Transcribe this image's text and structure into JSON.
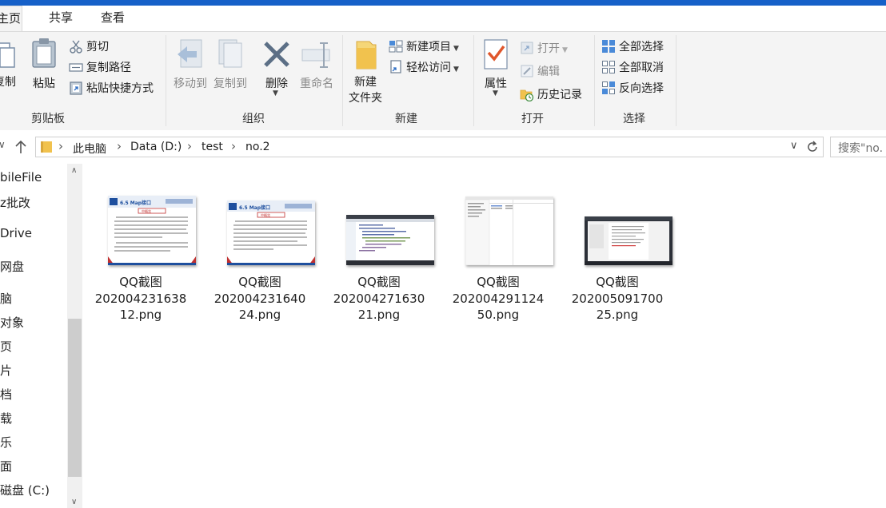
{
  "ribbon_tabs": [
    {
      "label": "主页",
      "active": true
    },
    {
      "label": "共享",
      "active": false
    },
    {
      "label": "查看",
      "active": false
    }
  ],
  "clipboard": {
    "group_label": "剪贴板",
    "copy_label": "复制",
    "paste_label": "粘贴",
    "cut_label": "剪切",
    "copy_path_label": "复制路径",
    "paste_shortcut_label": "粘贴快捷方式"
  },
  "organize": {
    "group_label": "组织",
    "move_to_label": "移动到",
    "copy_to_label": "复制到",
    "delete_label": "删除",
    "rename_label": "重命名"
  },
  "new": {
    "group_label": "新建",
    "new_folder_line1": "新建",
    "new_folder_line2": "文件夹",
    "new_item_label": "新建项目",
    "easy_access_label": "轻松访问"
  },
  "open": {
    "group_label": "打开",
    "properties_label": "属性",
    "open_label": "打开",
    "edit_label": "编辑",
    "history_label": "历史记录"
  },
  "select": {
    "group_label": "选择",
    "select_all_label": "全部选择",
    "select_none_label": "全部取消",
    "invert_label": "反向选择"
  },
  "breadcrumb": [
    "此电脑",
    "Data (D:)",
    "test",
    "no.2"
  ],
  "search_placeholder": "搜索\"no.",
  "sidebar_items": [
    "bileFile",
    "z批改",
    "Drive",
    "网盘",
    "脑",
    "对象",
    "页",
    "片",
    "档",
    "载",
    "乐",
    "面",
    "磁盘 (C:)"
  ],
  "files": [
    {
      "name_line1": "QQ截图",
      "name_line2": "202004231638",
      "name_line3": "12.png"
    },
    {
      "name_line1": "QQ截图",
      "name_line2": "202004231640",
      "name_line3": "24.png"
    },
    {
      "name_line1": "QQ截图",
      "name_line2": "202004271630",
      "name_line3": "21.png"
    },
    {
      "name_line1": "QQ截图",
      "name_line2": "202004291124",
      "name_line3": "50.png"
    },
    {
      "name_line1": "QQ截图",
      "name_line2": "202005091700",
      "name_line3": "25.png"
    }
  ],
  "thumb1": {
    "title": "6.5 Map接口",
    "subtitle": "中概览"
  },
  "thumb2": {
    "title": "6.5 Map接口",
    "subtitle": "中概览"
  },
  "colors": {
    "accent": "#1660c8",
    "folder": "#f1c24e",
    "properties_check": "#e0562b"
  }
}
